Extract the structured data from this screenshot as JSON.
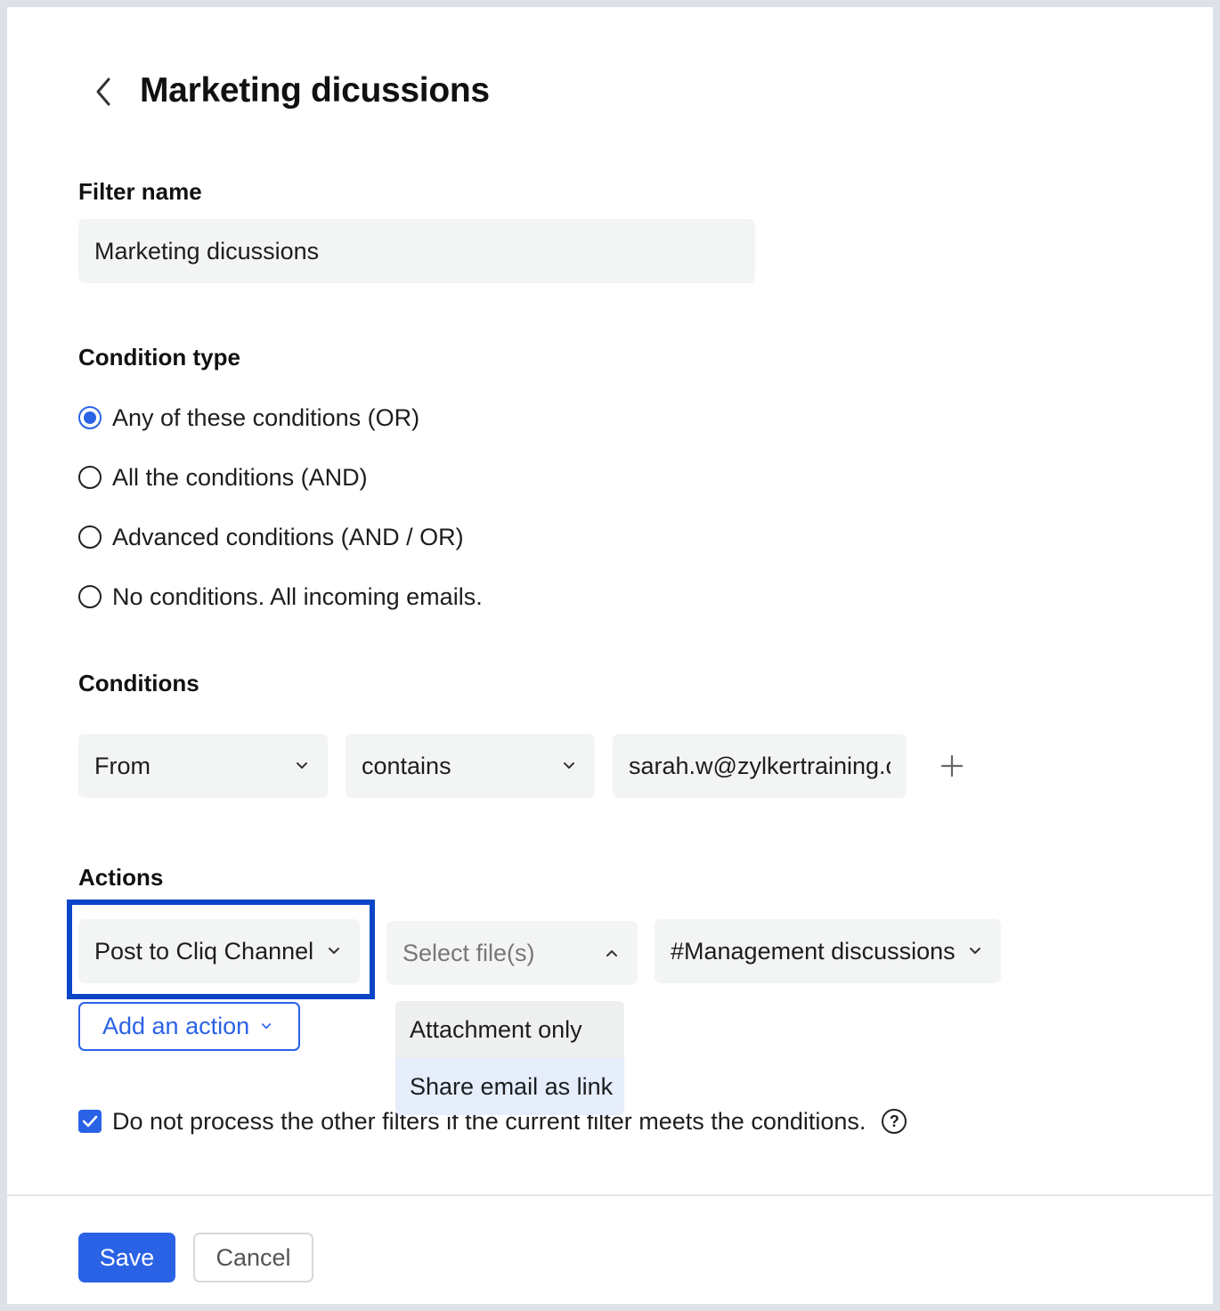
{
  "header": {
    "title": "Marketing dicussions",
    "back_icon": "chevron-left-icon"
  },
  "filter_name": {
    "label": "Filter name",
    "value": "Marketing dicussions"
  },
  "condition_type": {
    "label": "Condition type",
    "options": [
      {
        "label": "Any of these conditions (OR)",
        "checked": true
      },
      {
        "label": "All the conditions (AND)",
        "checked": false
      },
      {
        "label": "Advanced conditions (AND / OR)",
        "checked": false
      },
      {
        "label": "No conditions. All incoming emails.",
        "checked": false
      }
    ]
  },
  "conditions": {
    "label": "Conditions",
    "field": "From",
    "operator": "contains",
    "value": "sarah.w@zylkertraining.c",
    "add_icon": "plus-icon"
  },
  "actions": {
    "label": "Actions",
    "action_type": "Post to Cliq Channel",
    "file_select_placeholder": "Select file(s)",
    "channel": "#Management discussions",
    "add_action_label": "Add an action",
    "file_menu": [
      "Attachment only",
      "Share email as link"
    ]
  },
  "options": {
    "stop_processing_label": "Do not process the other filters if the current filter meets the conditions.",
    "stop_processing_checked": true,
    "help_icon": "question-icon"
  },
  "footer": {
    "save_label": "Save",
    "cancel_label": "Cancel"
  },
  "colors": {
    "accent": "#2a62e6",
    "highlight_border": "#0a45c8",
    "field_bg": "#f3f4f4"
  }
}
